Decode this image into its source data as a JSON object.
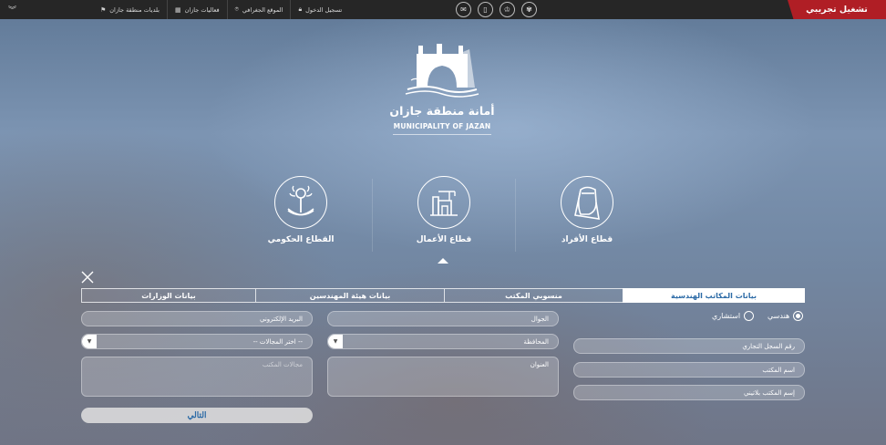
{
  "topbar": {
    "trial_label": "تشغيل تجريبي",
    "links": [
      {
        "label": "تسجيل الدخول",
        "icon": "lock-icon"
      },
      {
        "label": "الموقع الجغرافي",
        "icon": "map-pin-icon"
      },
      {
        "label": "فعاليات جازان",
        "icon": "calendar-icon"
      },
      {
        "label": "بلديات منطقة جازان",
        "icon": "flag-icon"
      }
    ],
    "social_icons": [
      "emblem-icon",
      "award-icon",
      "mobile-icon",
      "mail-icon"
    ]
  },
  "logo": {
    "arabic": "أمانة منطقة جازان",
    "english": "MUNICIPALITY OF JAZAN"
  },
  "sectors": [
    {
      "label": "قطاع الأفراد",
      "icon": "person-icon"
    },
    {
      "label": "قطاع الأعمال",
      "icon": "building-icon"
    },
    {
      "label": "القطاع الحكومي",
      "icon": "government-emblem-icon"
    }
  ],
  "tabs": [
    {
      "label": "بيانات المكاتب الهندسية",
      "active": true
    },
    {
      "label": "منسوبي المكتب",
      "active": false
    },
    {
      "label": "بيانات هيئة المهندسين",
      "active": false
    },
    {
      "label": "بيانات الوزارات",
      "active": false
    }
  ],
  "form": {
    "office_type": {
      "options": [
        "هندسي",
        "استشاري"
      ],
      "selected": "هندسي"
    },
    "commercial_register": "رقم السجل التجاري",
    "office_name": "اسم المكتب",
    "office_name_latin": "إسم المكتب بلاتيني",
    "mobile": "الجوال",
    "governorate_label": "المحافظة",
    "address": "العنوان",
    "email": "البريد الإلكتروني",
    "fields_select": "-- اختر المجالات --",
    "office_fields_placeholder": "مجالات المكتب",
    "next_button": "التالي"
  },
  "colors": {
    "topbar": "#262626",
    "trial_badge": "#b01e25",
    "active_tab_text": "#2b6aa6"
  }
}
